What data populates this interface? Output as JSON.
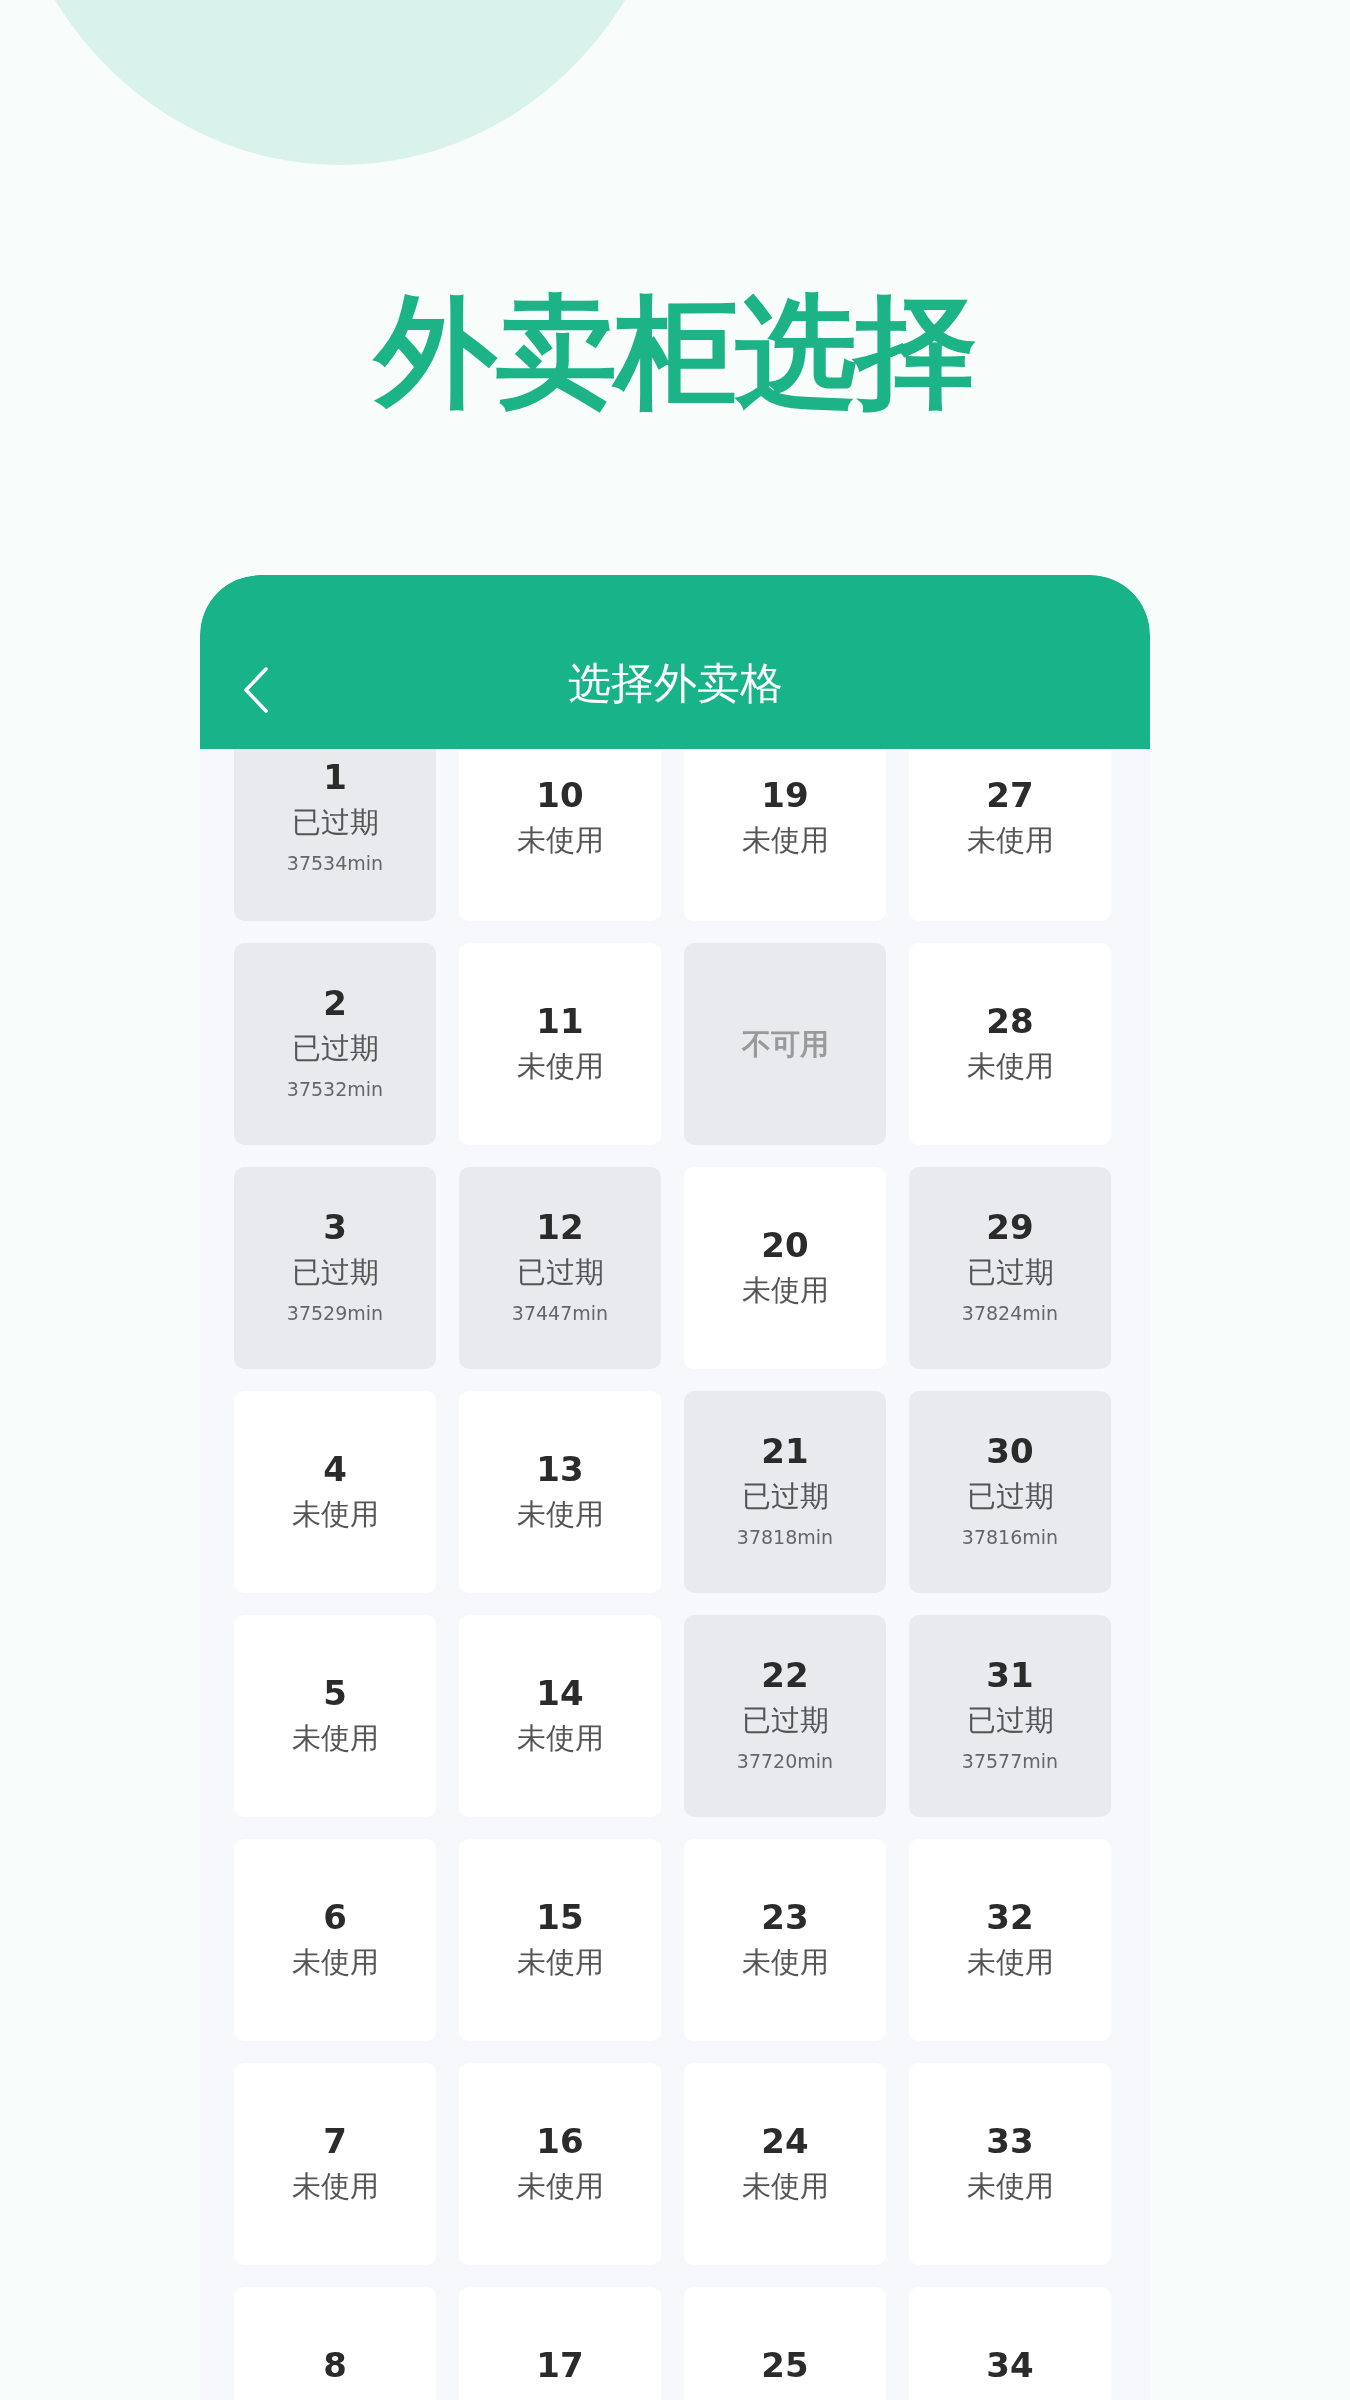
{
  "title": "外卖柜选择",
  "screen": {
    "header": {
      "title": "选择外卖格"
    },
    "rows": [
      [
        {
          "kind": "expired",
          "number": "1",
          "status": "已过期",
          "minutes": "37534min"
        },
        {
          "kind": "free",
          "number": "10",
          "status": "未使用"
        },
        {
          "kind": "free",
          "number": "19",
          "status": "未使用"
        },
        {
          "kind": "free",
          "number": "27",
          "status": "未使用"
        }
      ],
      [
        {
          "kind": "expired",
          "number": "2",
          "status": "已过期",
          "minutes": "37532min"
        },
        {
          "kind": "free",
          "number": "11",
          "status": "未使用"
        },
        {
          "kind": "unavailable",
          "status": "不可用"
        },
        {
          "kind": "free",
          "number": "28",
          "status": "未使用"
        }
      ],
      [
        {
          "kind": "expired",
          "number": "3",
          "status": "已过期",
          "minutes": "37529min"
        },
        {
          "kind": "expired",
          "number": "12",
          "status": "已过期",
          "minutes": "37447min"
        },
        {
          "kind": "free",
          "number": "20",
          "status": "未使用"
        },
        {
          "kind": "expired",
          "number": "29",
          "status": "已过期",
          "minutes": "37824min"
        }
      ],
      [
        {
          "kind": "free",
          "number": "4",
          "status": "未使用"
        },
        {
          "kind": "free",
          "number": "13",
          "status": "未使用"
        },
        {
          "kind": "expired",
          "number": "21",
          "status": "已过期",
          "minutes": "37818min"
        },
        {
          "kind": "expired",
          "number": "30",
          "status": "已过期",
          "minutes": "37816min"
        }
      ],
      [
        {
          "kind": "free",
          "number": "5",
          "status": "未使用"
        },
        {
          "kind": "free",
          "number": "14",
          "status": "未使用"
        },
        {
          "kind": "expired",
          "number": "22",
          "status": "已过期",
          "minutes": "37720min"
        },
        {
          "kind": "expired",
          "number": "31",
          "status": "已过期",
          "minutes": "37577min"
        }
      ],
      [
        {
          "kind": "free",
          "number": "6",
          "status": "未使用"
        },
        {
          "kind": "free",
          "number": "15",
          "status": "未使用"
        },
        {
          "kind": "free",
          "number": "23",
          "status": "未使用"
        },
        {
          "kind": "free",
          "number": "32",
          "status": "未使用"
        }
      ],
      [
        {
          "kind": "free",
          "number": "7",
          "status": "未使用"
        },
        {
          "kind": "free",
          "number": "16",
          "status": "未使用"
        },
        {
          "kind": "free",
          "number": "24",
          "status": "未使用"
        },
        {
          "kind": "free",
          "number": "33",
          "status": "未使用"
        }
      ],
      [
        {
          "kind": "free",
          "number": "8"
        },
        {
          "kind": "free",
          "number": "17"
        },
        {
          "kind": "free",
          "number": "25"
        },
        {
          "kind": "free",
          "number": "34"
        }
      ]
    ]
  }
}
